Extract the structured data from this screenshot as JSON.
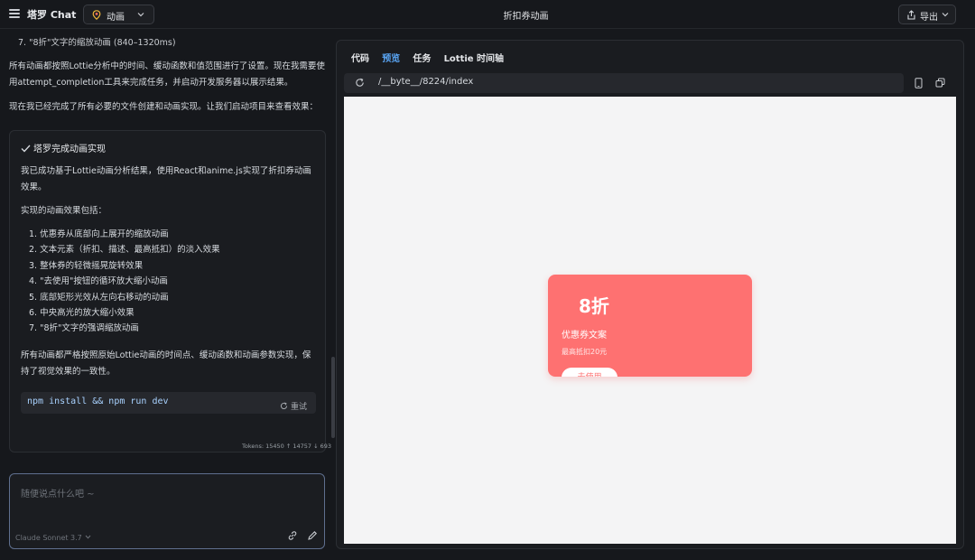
{
  "header": {
    "app_title": "塔罗 Chat",
    "mode": "动画",
    "page_title": "折扣券动画",
    "export_label": "导出"
  },
  "chat": {
    "cut_line": "7. \"8折\"文字的缩放动画 (840–1320ms)",
    "msg1": "所有动画都按照Lottie分析中的时间、缓动函数和值范围进行了设置。现在我需要使用attempt_completion工具来完成任务，并启动开发服务器以展示结果。",
    "msg2": "现在我已经完成了所有必要的文件创建和动画实现。让我们启动项目来查看效果：",
    "card": {
      "title": "塔罗完成动画实现",
      "intro": "我已成功基于Lottie动画分析结果，使用React和anime.js实现了折扣券动画效果。",
      "effects_heading": "实现的动画效果包括：",
      "effects": [
        "1. 优惠券从底部向上展开的缩放动画",
        "2. 文本元素（折扣、描述、最高抵扣）的淡入效果",
        "3. 整体券的轻微摇晃旋转效果",
        "4. \"去使用\"按钮的循环放大缩小动画",
        "5. 底部矩形光效从左向右移动的动画",
        "6. 中央高光的放大缩小效果",
        "7. \"8折\"文字的强调缩放动画"
      ],
      "summary": "所有动画都严格按照原始Lottie动画的时间点、缓动函数和动画参数实现，保持了视觉效果的一致性。",
      "command": "npm install && npm run dev",
      "retry_label": "重试"
    },
    "tokens": "Tokens: 15450 ↑ 14757 ↓ 693",
    "input_placeholder": "随便说点什么吧 ~",
    "model": "Claude Sonnet 3.7"
  },
  "preview": {
    "tabs": [
      {
        "label": "代码",
        "active": false
      },
      {
        "label": "预览",
        "active": true
      },
      {
        "label": "任务",
        "active": false
      },
      {
        "label": "Lottie 时间轴",
        "active": false
      }
    ],
    "url": "/__byte__/8224/index",
    "coupon": {
      "discount": "8折",
      "description": "优惠券文案",
      "max_deduction": "最高抵扣20元",
      "button": "去使用"
    }
  },
  "colors": {
    "accent": "#5aa6f5",
    "coupon": "#fe7171",
    "background": "#16181c"
  }
}
